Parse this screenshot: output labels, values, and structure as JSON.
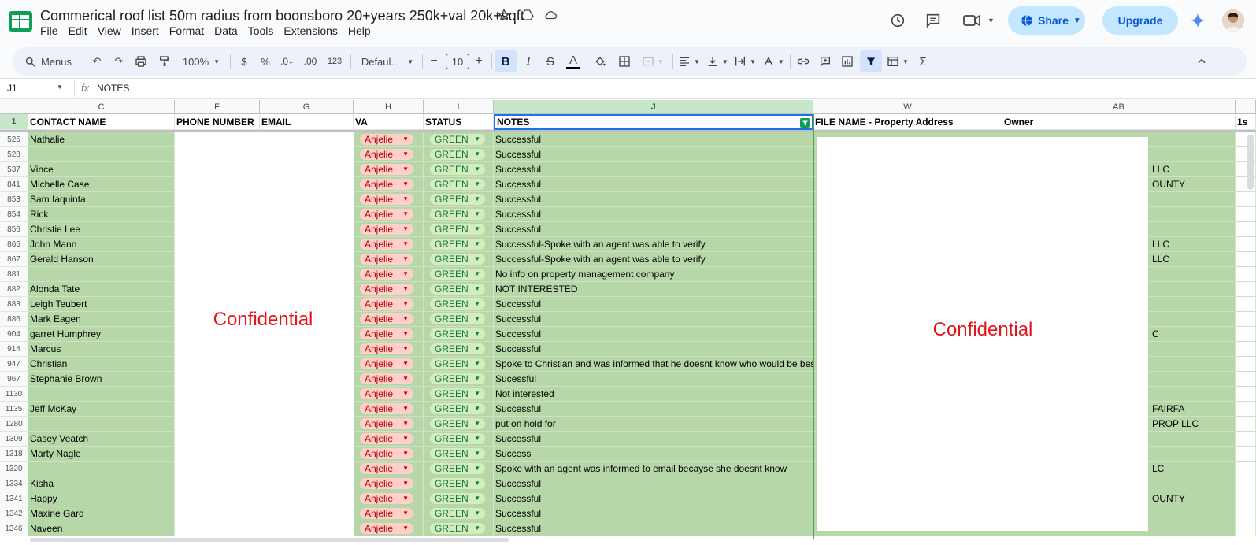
{
  "doc": {
    "title": "Commerical roof list 50m radius from boonsboro 20+years 250k+val 20k+sqft",
    "menu": [
      "File",
      "Edit",
      "View",
      "Insert",
      "Format",
      "Data",
      "Tools",
      "Extensions",
      "Help"
    ]
  },
  "header": {
    "share_label": "Share",
    "upgrade_label": "Upgrade",
    "icons": [
      "star-icon",
      "move-to-drive-icon",
      "cloud-status-icon",
      "history-icon",
      "comment-icon",
      "meet-icon",
      "gemini-icon"
    ]
  },
  "toolbar": {
    "search_label": "Menus",
    "zoom": "100%",
    "currency": "$",
    "percent": "%",
    "dec_decrease": ".0←",
    "dec_increase": ".00",
    "format_123": "123",
    "font": "Defaul...",
    "font_size": "10",
    "minus": "−",
    "plus": "+",
    "bold": "B",
    "italic": "I",
    "strike": "S",
    "text_color": "A",
    "sum": "Σ"
  },
  "formula_bar": {
    "name_box": "J1",
    "fx": "fx",
    "content": "NOTES"
  },
  "colors": {
    "green_fill": "#b6d7a8",
    "va_chip_bg": "#ffcfc9",
    "va_chip_text": "#b10202",
    "status_chip_bg": "#d4edbc",
    "status_chip_text": "#11734b",
    "confidential_text": "#e3151a",
    "accent": "#0b57d0"
  },
  "columns": {
    "letters": [
      "C",
      "F",
      "G",
      "H",
      "I",
      "J",
      "W",
      "AB"
    ],
    "headers": [
      "CONTACT NAME",
      "PHONE NUMBER",
      "EMAIL",
      "VA",
      "STATUS",
      "NOTES",
      "FILE NAME - Property Address",
      "Owner",
      "1s"
    ]
  },
  "row1_number": "1",
  "rows": [
    {
      "num": "525",
      "contact": "Nathalie",
      "va": "Anjelie",
      "status": "GREEN",
      "notes": "Successful",
      "owner": ""
    },
    {
      "num": "528",
      "contact": "",
      "va": "Anjelie",
      "status": "GREEN",
      "notes": "Successful",
      "owner": ""
    },
    {
      "num": "537",
      "contact": "Vince",
      "va": "Anjelie",
      "status": "GREEN",
      "notes": "Successful",
      "owner": "LLC"
    },
    {
      "num": "841",
      "contact": "Michelle Case",
      "va": "Anjelie",
      "status": "GREEN",
      "notes": "Successful",
      "owner": "OUNTY"
    },
    {
      "num": "853",
      "contact": "Sam Iaquinta",
      "va": "Anjelie",
      "status": "GREEN",
      "notes": "Successful",
      "owner": ""
    },
    {
      "num": "854",
      "contact": "Rick",
      "va": "Anjelie",
      "status": "GREEN",
      "notes": "Successful",
      "owner": ""
    },
    {
      "num": "856",
      "contact": "Christie Lee",
      "va": "Anjelie",
      "status": "GREEN",
      "notes": "Successful",
      "owner": ""
    },
    {
      "num": "865",
      "contact": "John Mann",
      "va": "Anjelie",
      "status": "GREEN",
      "notes": "Successful-Spoke with an agent was able to verify",
      "owner": "LLC"
    },
    {
      "num": "867",
      "contact": "Gerald Hanson",
      "va": "Anjelie",
      "status": "GREEN",
      "notes": "Successful-Spoke with an agent was able to verify",
      "owner": "LLC"
    },
    {
      "num": "881",
      "contact": "",
      "va": "Anjelie",
      "status": "GREEN",
      "notes": "No info on property management company",
      "owner": ""
    },
    {
      "num": "882",
      "contact": "Alonda Tate",
      "va": "Anjelie",
      "status": "GREEN",
      "notes": "NOT INTERESTED",
      "owner": ""
    },
    {
      "num": "883",
      "contact": "Leigh Teubert",
      "va": "Anjelie",
      "status": "GREEN",
      "notes": "Successful",
      "owner": ""
    },
    {
      "num": "886",
      "contact": "Mark Eagen",
      "va": "Anjelie",
      "status": "GREEN",
      "notes": "Successful",
      "owner": ""
    },
    {
      "num": "904",
      "contact": "garret Humphrey",
      "va": "Anjelie",
      "status": "GREEN",
      "notes": "Successful",
      "owner": "C"
    },
    {
      "num": "914",
      "contact": "Marcus",
      "va": "Anjelie",
      "status": "GREEN",
      "notes": "Successful",
      "owner": ""
    },
    {
      "num": "947",
      "contact": "Christian",
      "va": "Anjelie",
      "status": "GREEN",
      "notes": "Spoke to Christian and was informed that he doesnt know who would be bes",
      "owner": ""
    },
    {
      "num": "967",
      "contact": "Stephanie Brown",
      "va": "Anjelie",
      "status": "GREEN",
      "notes": "Sucessful",
      "owner": ""
    },
    {
      "num": "1130",
      "contact": "",
      "va": "Anjelie",
      "status": "GREEN",
      "notes": "Not interested",
      "owner": ""
    },
    {
      "num": "1135",
      "contact": "Jeff McKay",
      "va": "Anjelie",
      "status": "GREEN",
      "notes": "Successful",
      "owner": "FAIRFA"
    },
    {
      "num": "1280",
      "contact": "",
      "va": "Anjelie",
      "status": "GREEN",
      "notes": "put on hold for",
      "owner": "PROP LLC"
    },
    {
      "num": "1309",
      "contact": "Casey Veatch",
      "va": "Anjelie",
      "status": "GREEN",
      "notes": "Successful",
      "owner": ""
    },
    {
      "num": "1318",
      "contact": "Marty Nagle",
      "va": "Anjelie",
      "status": "GREEN",
      "notes": "Success",
      "owner": ""
    },
    {
      "num": "1320",
      "contact": "",
      "va": "Anjelie",
      "status": "GREEN",
      "notes": "Spoke with an agent was informed to email becayse she doesnt know",
      "owner": "LC"
    },
    {
      "num": "1334",
      "contact": "Kisha",
      "va": "Anjelie",
      "status": "GREEN",
      "notes": "Successful",
      "owner": ""
    },
    {
      "num": "1341",
      "contact": "Happy",
      "va": "Anjelie",
      "status": "GREEN",
      "notes": "Successful",
      "owner": "OUNTY"
    },
    {
      "num": "1342",
      "contact": "Maxine Gard",
      "va": "Anjelie",
      "status": "GREEN",
      "notes": "Successful",
      "owner": ""
    },
    {
      "num": "1346",
      "contact": "Naveen",
      "va": "Anjelie",
      "status": "GREEN",
      "notes": "Successful",
      "owner": ""
    }
  ],
  "redactions": [
    "Confidential",
    "Confidential"
  ]
}
